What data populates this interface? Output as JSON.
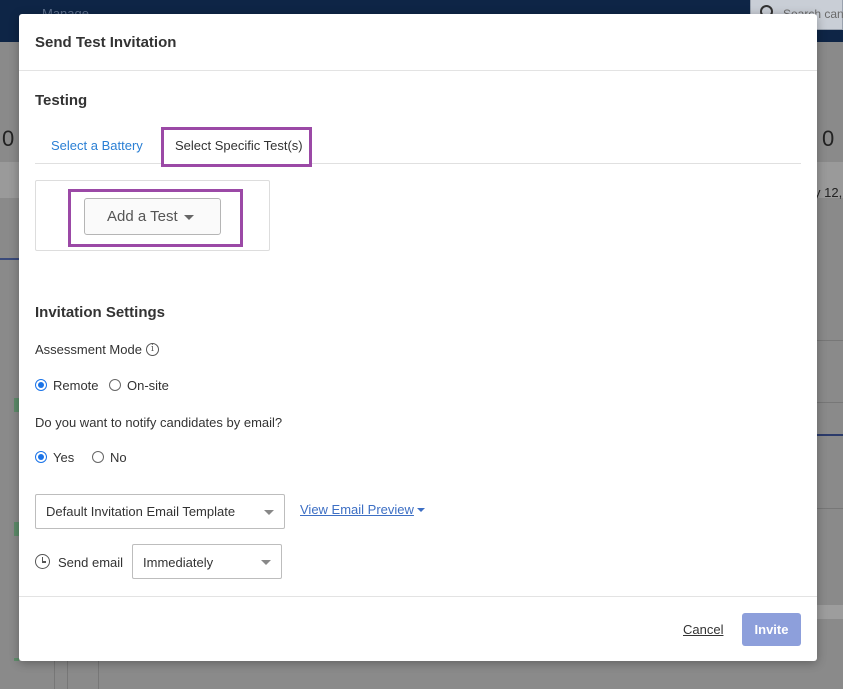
{
  "background": {
    "menu_label": "Manage",
    "search_placeholder": "Search can",
    "left_number": "0",
    "right_number": "0",
    "right_date": "y 12,"
  },
  "modal": {
    "title": "Send Test Invitation",
    "testing": {
      "heading": "Testing",
      "tabs": [
        {
          "label": "Select a Battery",
          "active": false
        },
        {
          "label": "Select Specific Test(s)",
          "active": true
        }
      ],
      "add_test_label": "Add a Test"
    },
    "settings": {
      "heading": "Invitation Settings",
      "assessment_mode_label": "Assessment Mode",
      "info_glyph": "i",
      "mode_options": [
        {
          "label": "Remote",
          "checked": true
        },
        {
          "label": "On-site",
          "checked": false
        }
      ],
      "notify_question": "Do you want to notify candidates by email?",
      "notify_options": [
        {
          "label": "Yes",
          "checked": true
        },
        {
          "label": "No",
          "checked": false
        }
      ],
      "template_value": "Default Invitation Email Template",
      "preview_link": "View Email Preview",
      "send_email_label": "Send email",
      "send_timing_value": "Immediately"
    },
    "footer": {
      "cancel_label": "Cancel",
      "invite_label": "Invite"
    }
  },
  "colors": {
    "highlight": "#9b49a6",
    "link": "#2a7fd4",
    "invite": "#8d9fdb",
    "radio_selected": "#1a73e8"
  }
}
